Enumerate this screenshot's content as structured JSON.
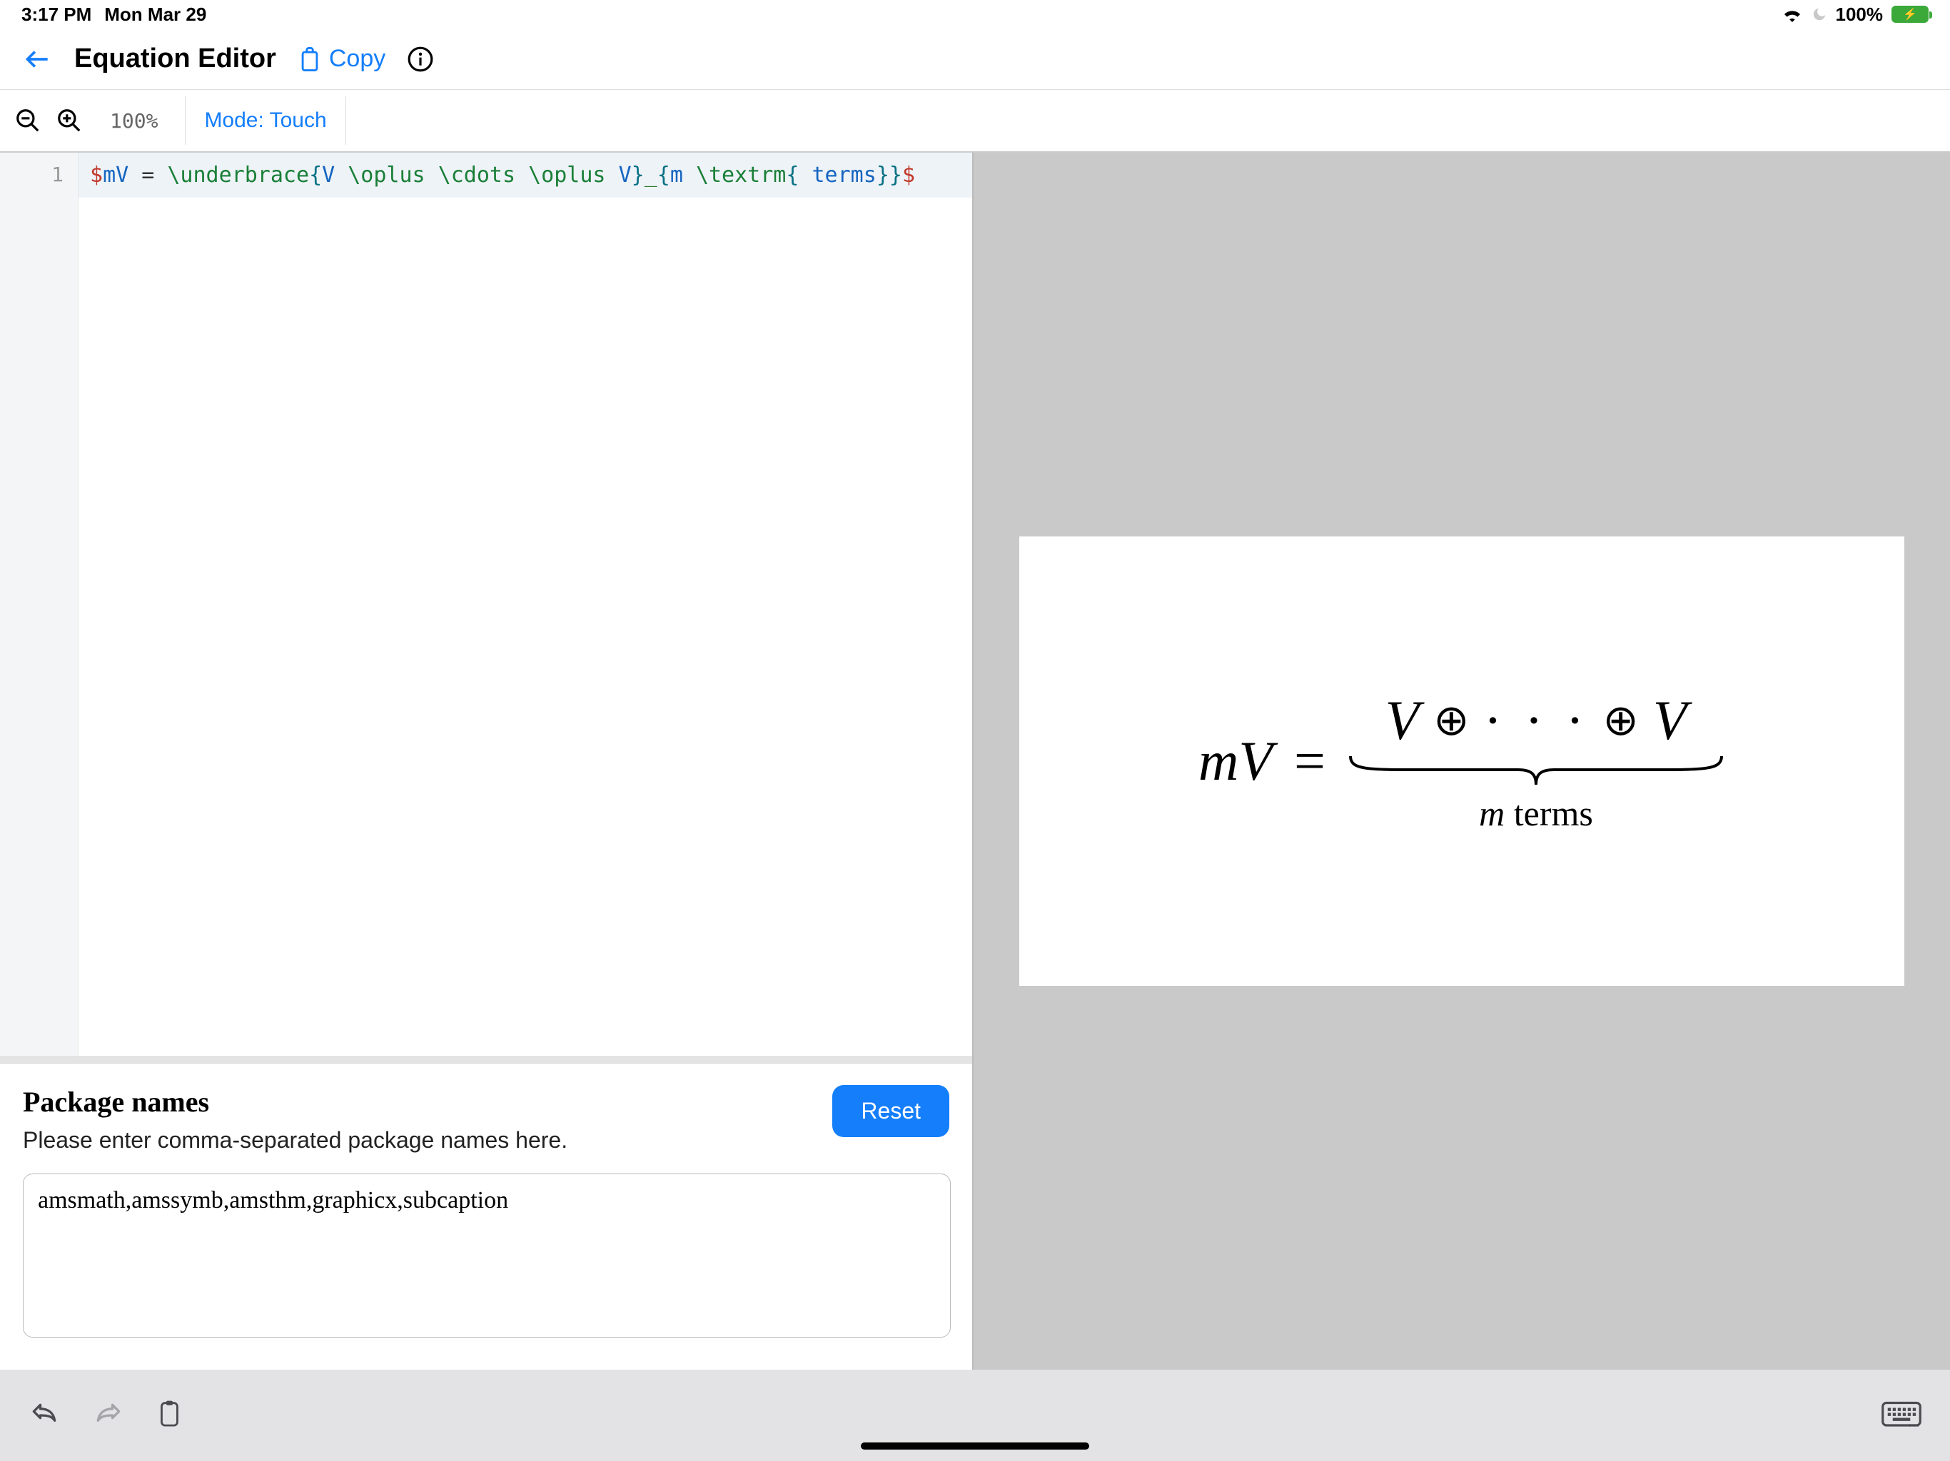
{
  "status": {
    "time": "3:17 PM",
    "date": "Mon Mar 29",
    "battery": "100%"
  },
  "header": {
    "title": "Equation Editor",
    "copy": "Copy"
  },
  "toolbar": {
    "zoom": "100%",
    "mode": "Mode: Touch"
  },
  "code": {
    "line_number": "1",
    "segments": {
      "d1": "$",
      "mV": "mV",
      "sp1": " ",
      "eq": "=",
      "sp2": " ",
      "ub": "\\underbrace",
      "b1": "{",
      "V1": "V",
      "sp3": " ",
      "op1": "\\oplus",
      "sp4": " ",
      "cd": "\\cdots",
      "sp5": " ",
      "op2": "\\oplus",
      "sp6": " ",
      "V2": "V",
      "b2": "}",
      "us": "_",
      "b3": "{",
      "m": "m",
      "sp7": " ",
      "tr": "\\textrm",
      "b4": "{",
      "sp8": " ",
      "terms": "terms",
      "b5": "}",
      "b6": "}",
      "d2": "$"
    }
  },
  "packages": {
    "title": "Package names",
    "hint": "Please enter comma-separated package names here.",
    "reset": "Reset",
    "value": "amsmath,amssymb,amsthm,graphicx,subcaption"
  },
  "preview": {
    "lhs_m": "m",
    "lhs_V": "V",
    "eq": "=",
    "rhs_V1": "V",
    "oplus": "⊕",
    "cdots": "· · ·",
    "rhs_V2": "V",
    "sub_m": "m",
    "sub_terms": " terms"
  }
}
